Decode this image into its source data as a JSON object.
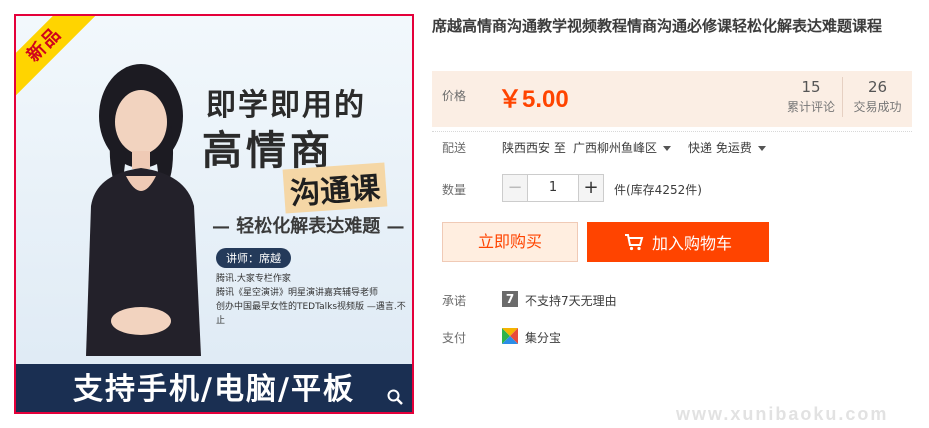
{
  "image": {
    "badge": "新品",
    "title_line1": "即学即用的",
    "title_line2": "高情商",
    "title_line3": "沟通课",
    "subtitle": "— 轻松化解表达难题 —",
    "lecturer": "讲师：席越",
    "bio": [
      "腾讯.大家专栏作家",
      "腾讯《星空演讲》明星演讲嘉宾辅导老师",
      "创办中国最早女性的TEDTalks视频版 —遇言.不止"
    ],
    "banner": "支持手机/电脑/平板"
  },
  "product": {
    "title": "席越高情商沟通教学视频教程情商沟通必修课轻松化解表达难题课程"
  },
  "price": {
    "label": "价格",
    "value": "￥5.00",
    "reviews_count": "15",
    "reviews_label": "累计评论",
    "trades_count": "26",
    "trades_label": "交易成功"
  },
  "delivery": {
    "label": "配送",
    "origin": "陕西西安 至",
    "destination": "广西柳州鱼峰区",
    "method": "快递 免运费"
  },
  "quantity": {
    "label": "数量",
    "value": "1",
    "minus": "−",
    "plus": "+",
    "stock": "件(库存4252件)"
  },
  "actions": {
    "buy_now": "立即购买",
    "add_cart": "加入购物车"
  },
  "pledge": {
    "label": "承诺",
    "icon_text": "7",
    "value": "不支持7天无理由"
  },
  "payment": {
    "label": "支付",
    "value": "集分宝"
  },
  "watermark": "www.xunibaoku.com",
  "colors": {
    "accent": "#ff4400",
    "price_bg": "#fbeee4",
    "image_border": "#e4003a",
    "banner_bg": "#1a2f52"
  }
}
